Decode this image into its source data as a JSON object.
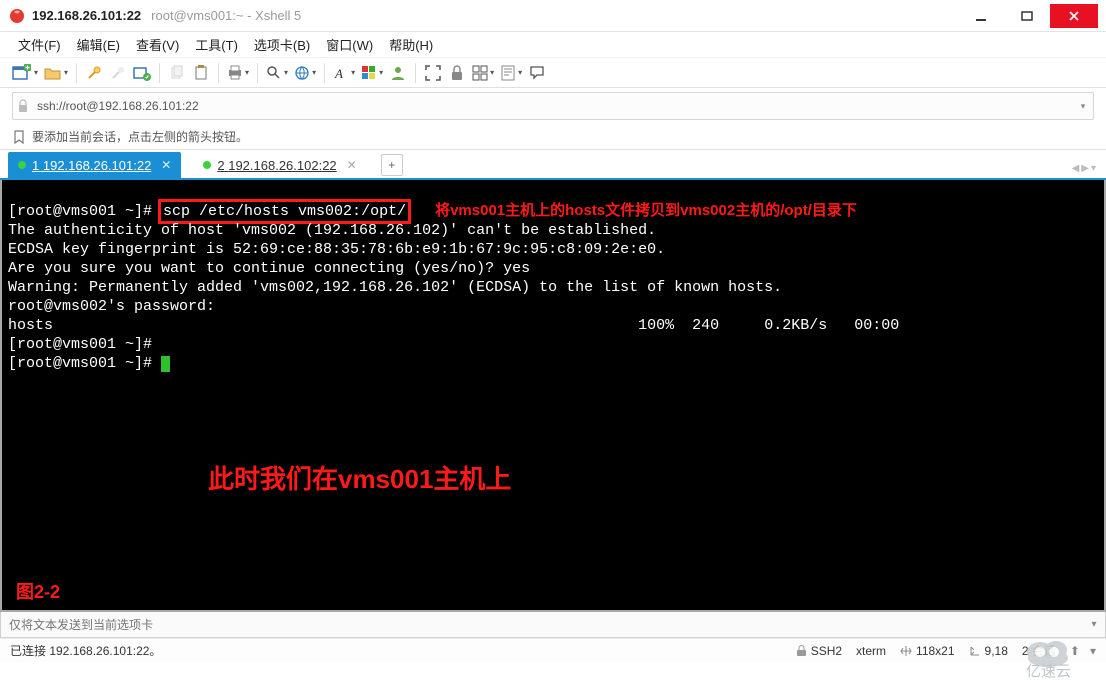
{
  "title": {
    "ip": "192.168.26.101:22",
    "subtitle": "root@vms001:~ - Xshell 5"
  },
  "menu": {
    "file": "文件(F)",
    "edit": "编辑(E)",
    "view": "查看(V)",
    "tools": "工具(T)",
    "tabs": "选项卡(B)",
    "window": "窗口(W)",
    "help": "帮助(H)"
  },
  "address": {
    "url": "ssh://root@192.168.26.101:22"
  },
  "hint": {
    "text": "要添加当前会话，点击左侧的箭头按钮。"
  },
  "tabs": {
    "t1_index": "1",
    "t1_label": "192.168.26.101:22",
    "t2_index": "2",
    "t2_label": "192.168.26.102:22"
  },
  "terminal": {
    "prompt1_a": "[root@vms001 ~]# ",
    "scp_cmd": "scp /etc/hosts vms002:/opt/",
    "annot1": "将vms001主机上的hosts文件拷贝到vms002主机的/opt/目录下",
    "l2": "The authenticity of host 'vms002 (192.168.26.102)' can't be established.",
    "l3": "ECDSA key fingerprint is 52:69:ce:88:35:78:6b:e9:1b:67:9c:95:c8:09:2e:e0.",
    "l4": "Are you sure you want to continue connecting (yes/no)? yes",
    "l5": "Warning: Permanently added 'vms002,192.168.26.102' (ECDSA) to the list of known hosts.",
    "l6": "root@vms002's password:",
    "l7_name": "hosts",
    "l7_pct": "100%",
    "l7_size": "240",
    "l7_speed": "0.2KB/s",
    "l7_time": "00:00",
    "prompt2": "[root@vms001 ~]#",
    "prompt3": "[root@vms001 ~]# ",
    "big_annot": "此时我们在vms001主机上",
    "figure": "图2-2"
  },
  "sendbar": {
    "placeholder": "仅将文本发送到当前选项卡"
  },
  "status": {
    "conn": "已连接 192.168.26.101:22。",
    "proto": "SSH2",
    "term": "xterm",
    "size": "118x21",
    "cursor": "9,18",
    "sessions": "2 会话"
  },
  "watermark": "亿速云"
}
